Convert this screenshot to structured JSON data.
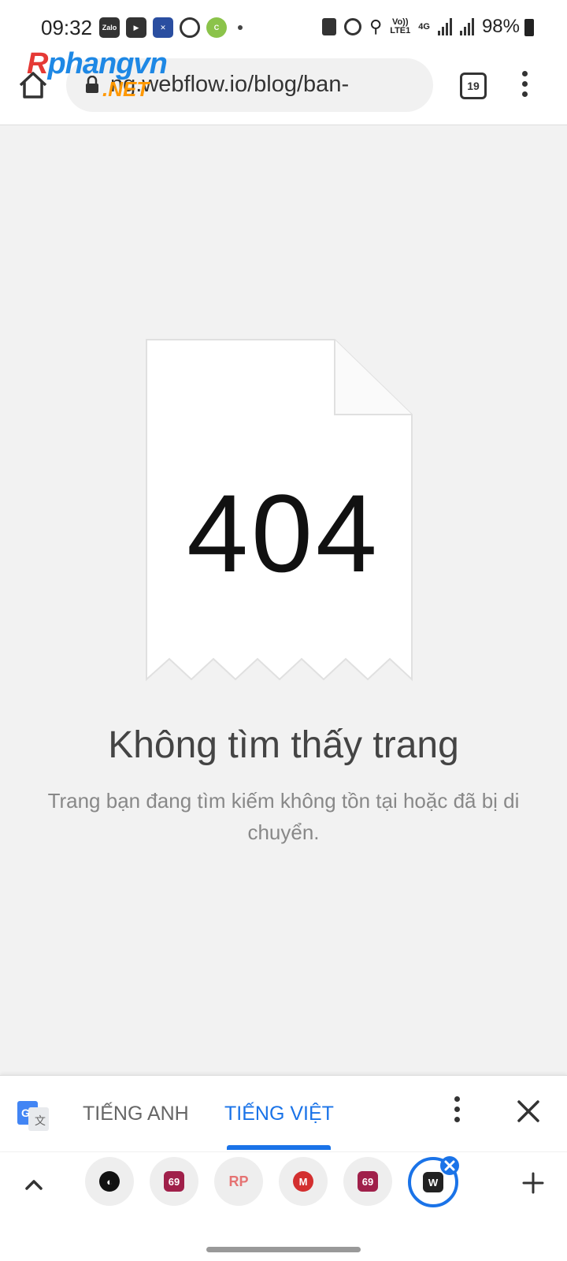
{
  "status_bar": {
    "time": "09:32",
    "network_labels": {
      "volte_top": "Vo))",
      "volte_bottom": "LTE1",
      "net_type": "4G"
    },
    "battery_percent": "98%",
    "left_icons": [
      "zalo-icon",
      "youtube-icon",
      "shield-app-icon",
      "alarm-icon",
      "green-app-icon",
      "more-dot-icon"
    ],
    "right_icons": [
      "recycle-icon",
      "alarm-icon",
      "location-icon",
      "signal-icon",
      "signal-icon",
      "battery-icon"
    ],
    "zalo_label": "Zalo"
  },
  "browser": {
    "url": "ng.webflow.io/blog/ban-",
    "tab_count": "19",
    "watermark": {
      "part1": "R",
      "part2": "phangvn",
      "suffix": ".NET"
    }
  },
  "page": {
    "error_code": "404",
    "title": "Không tìm thấy trang",
    "description": "Trang bạn đang tìm kiếm không tồn tại hoặc đã bị di chuyển."
  },
  "translate_bar": {
    "source_lang": "TIẾNG ANH",
    "target_lang": "TIẾNG VIỆT",
    "active": "target",
    "accent": "#1a73e8"
  },
  "tab_strip": {
    "tabs": [
      {
        "name": "globe",
        "label": ""
      },
      {
        "name": "69",
        "label": "69"
      },
      {
        "name": "rp",
        "label": "RP"
      },
      {
        "name": "mega",
        "label": "M"
      },
      {
        "name": "69-2",
        "label": "69"
      },
      {
        "name": "webflow",
        "label": "W",
        "active": true
      }
    ]
  }
}
